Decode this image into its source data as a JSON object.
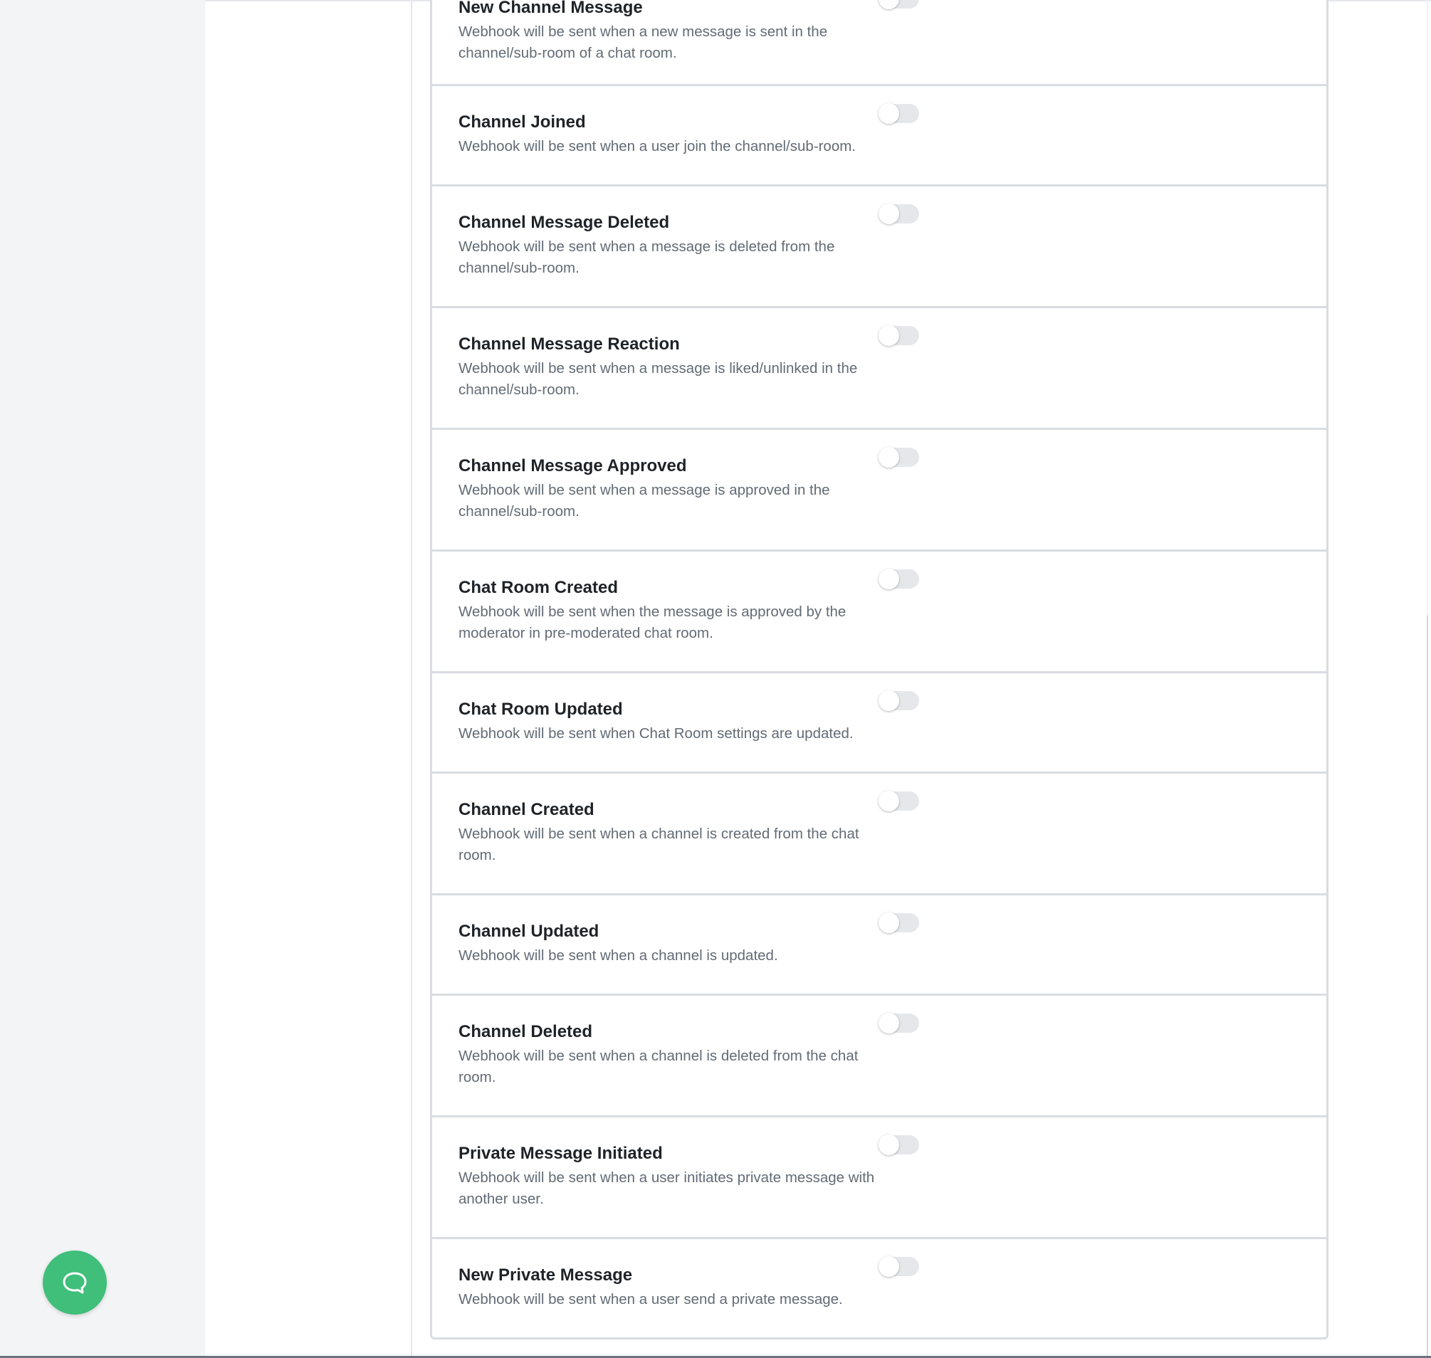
{
  "colors": {
    "accent": "#3fbf7a",
    "toggle_off": "#e5e7eb",
    "title_text": "#1f2328",
    "desc_text": "#636b75",
    "sidebar_bg": "#f3f4f6"
  },
  "chat_launcher": {
    "icon": "chat-bubble-icon"
  },
  "events": [
    {
      "title": "New Channel Message",
      "description": "Webhook will be sent when a new message is sent in the channel/sub-room of a chat room.",
      "enabled": false
    },
    {
      "title": "Channel Joined",
      "description": "Webhook will be sent when a user join the channel/sub-room.",
      "enabled": false
    },
    {
      "title": "Channel Message Deleted",
      "description": "Webhook will be sent when a message is deleted from the channel/sub-room.",
      "enabled": false
    },
    {
      "title": "Channel Message Reaction",
      "description": "Webhook will be sent when a message is liked/unlinked in the channel/sub-room.",
      "enabled": false
    },
    {
      "title": "Channel Message Approved",
      "description": "Webhook will be sent when a message is approved in the channel/sub-room.",
      "enabled": false
    },
    {
      "title": "Chat Room Created",
      "description": "Webhook will be sent when the message is approved by the moderator in pre-moderated chat room.",
      "enabled": false
    },
    {
      "title": "Chat Room Updated",
      "description": "Webhook will be sent when Chat Room settings are updated.",
      "enabled": false
    },
    {
      "title": "Channel Created",
      "description": "Webhook will be sent when a channel is created from the chat room.",
      "enabled": false
    },
    {
      "title": "Channel Updated",
      "description": "Webhook will be sent when a channel is updated.",
      "enabled": false
    },
    {
      "title": "Channel Deleted",
      "description": "Webhook will be sent when a channel is deleted from the chat room.",
      "enabled": false
    },
    {
      "title": "Private Message Initiated",
      "description": "Webhook will be sent when a user initiates private message with another user.",
      "enabled": false
    },
    {
      "title": "New Private Message",
      "description": "Webhook will be sent when a user send a private message.",
      "enabled": false
    }
  ]
}
